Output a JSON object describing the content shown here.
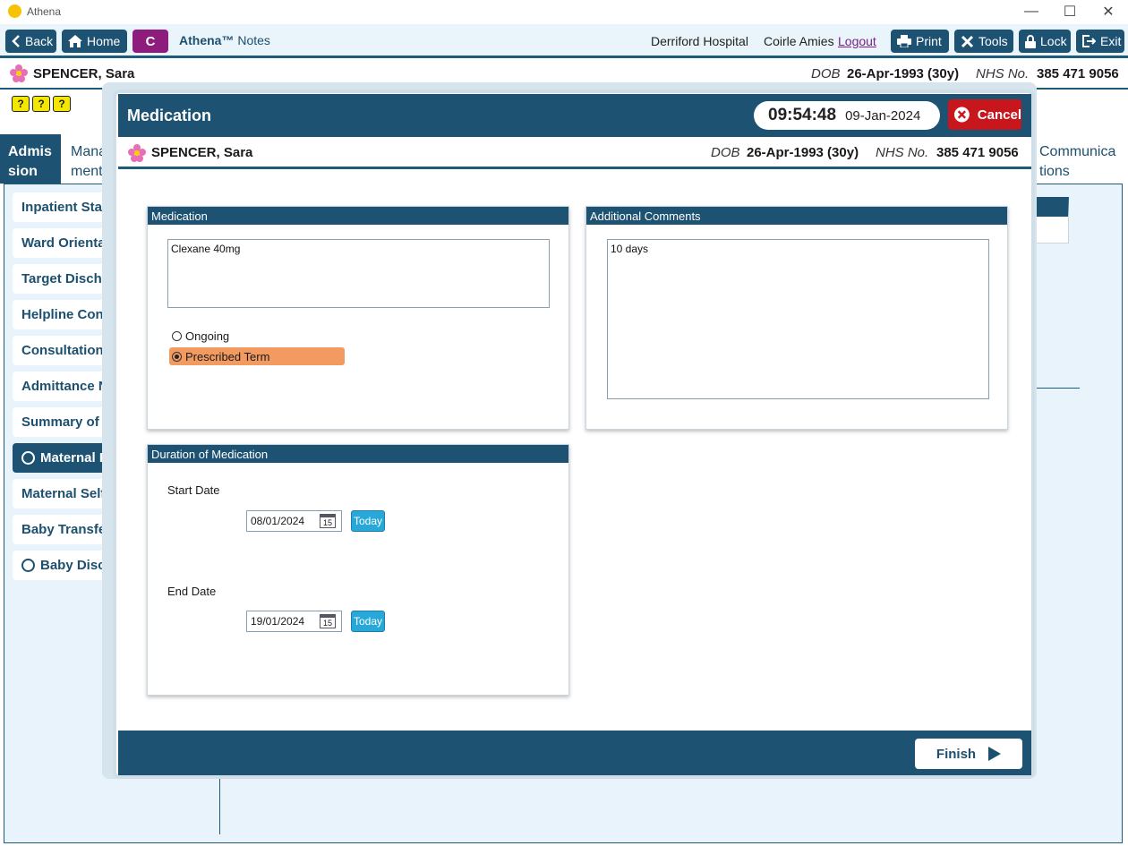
{
  "window": {
    "title": "Athena",
    "minimize": "—",
    "maximize": "☐",
    "close": "✕"
  },
  "toolbar": {
    "back": "Back",
    "home": "Home",
    "c_button": "C",
    "brand_name": "Athena™",
    "brand_sub": "Notes",
    "location": "Derriford Hospital",
    "user": "Coirle Amies",
    "logout": "Logout",
    "print": "Print",
    "tools": "Tools",
    "lock": "Lock",
    "exit": "Exit"
  },
  "patient": {
    "name": "SPENCER, Sara",
    "dob_label": "DOB",
    "dob": "26-Apr-1993 (30y)",
    "nhs_label": "NHS No.",
    "nhs": "385 471 9056"
  },
  "background": {
    "quick_icons": [
      "?",
      "?",
      "?"
    ],
    "tab_admission": "Admis sion",
    "tab_management": "Mana ment",
    "tab_communications": "Communica tions",
    "nav_items": [
      {
        "label": "Inpatient Stay",
        "radio": false,
        "active": false
      },
      {
        "label": "Ward Orientat",
        "radio": false,
        "active": false
      },
      {
        "label": "Target Dischar",
        "radio": false,
        "active": false
      },
      {
        "label": "Helpline Cont",
        "radio": false,
        "active": false
      },
      {
        "label": "Consultation I",
        "radio": false,
        "active": false
      },
      {
        "label": "Admittance N",
        "radio": false,
        "active": false
      },
      {
        "label": "Summary of P",
        "radio": false,
        "active": false
      },
      {
        "label": "Maternal Di",
        "radio": true,
        "active": true
      },
      {
        "label": "Maternal Self",
        "radio": false,
        "active": false
      },
      {
        "label": "Baby Transfer",
        "radio": false,
        "active": false
      },
      {
        "label": "Baby Discha",
        "radio": true,
        "active": false
      }
    ]
  },
  "modal": {
    "title": "Medication",
    "time": "09:54:48",
    "date": "09-Jan-2024",
    "cancel": "Cancel",
    "finish": "Finish",
    "medication_panel": {
      "header": "Medication",
      "value": "Clexane 40mg",
      "options": [
        {
          "label": "Ongoing",
          "selected": false
        },
        {
          "label": "Prescribed Term",
          "selected": true
        }
      ]
    },
    "comments_panel": {
      "header": "Additional Comments",
      "value": "10 days"
    },
    "duration_panel": {
      "header": "Duration of Medication",
      "start_label": "Start Date",
      "start_value": "08/01/2024",
      "end_label": "End Date",
      "end_value": "19/01/2024",
      "today": "Today",
      "calendar_day": "15"
    }
  },
  "colors": {
    "primary": "#1d5272",
    "accent_c": "#8e1c7d",
    "cancel": "#c8161d",
    "selected_option": "#f39a60",
    "today": "#27a8d8"
  }
}
